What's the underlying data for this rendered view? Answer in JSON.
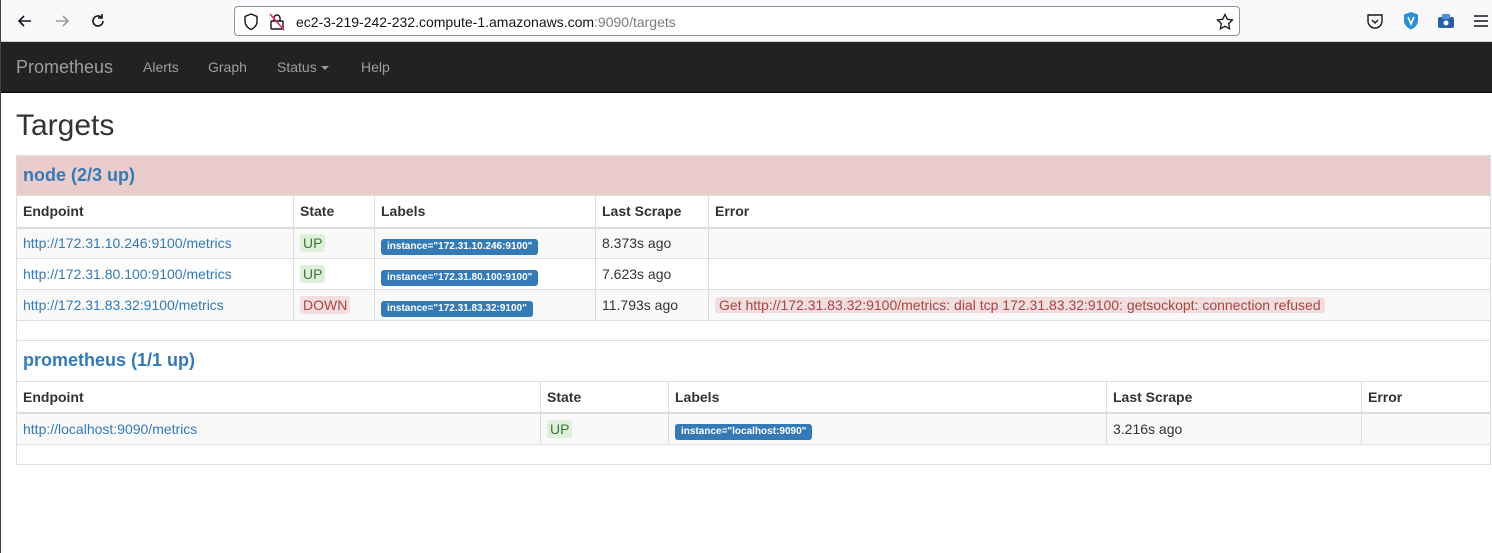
{
  "browser": {
    "url_host": "ec2-3-219-242-232.compute-1.amazonaws.com",
    "url_path": ":9090/targets"
  },
  "navbar": {
    "brand": "Prometheus",
    "items": [
      "Alerts",
      "Graph",
      "Status",
      "Help"
    ]
  },
  "page": {
    "title": "Targets"
  },
  "jobs": [
    {
      "title": "node (2/3 up)",
      "headers": [
        "Endpoint",
        "State",
        "Labels",
        "Last Scrape",
        "Error"
      ],
      "rows": [
        {
          "endpoint": "http://172.31.10.246:9100/metrics",
          "state": "UP",
          "label": "instance=\"172.31.10.246:9100\"",
          "last_scrape": "8.373s ago",
          "error": ""
        },
        {
          "endpoint": "http://172.31.80.100:9100/metrics",
          "state": "UP",
          "label": "instance=\"172.31.80.100:9100\"",
          "last_scrape": "7.623s ago",
          "error": ""
        },
        {
          "endpoint": "http://172.31.83.32:9100/metrics",
          "state": "DOWN",
          "label": "instance=\"172.31.83.32:9100\"",
          "last_scrape": "11.793s ago",
          "error": "Get http://172.31.83.32:9100/metrics: dial tcp 172.31.83.32:9100: getsockopt: connection refused"
        }
      ]
    },
    {
      "title": "prometheus (1/1 up)",
      "headers": [
        "Endpoint",
        "State",
        "Labels",
        "Last Scrape",
        "Error"
      ],
      "rows": [
        {
          "endpoint": "http://localhost:9090/metrics",
          "state": "UP",
          "label": "instance=\"localhost:9090\"",
          "last_scrape": "3.216s ago",
          "error": ""
        }
      ]
    }
  ],
  "colors": {
    "navbar": "#222222",
    "link": "#337ab7",
    "up_bg": "#dff0d8",
    "down_bg": "#f2dede",
    "danger_header": "#ebcccc"
  }
}
